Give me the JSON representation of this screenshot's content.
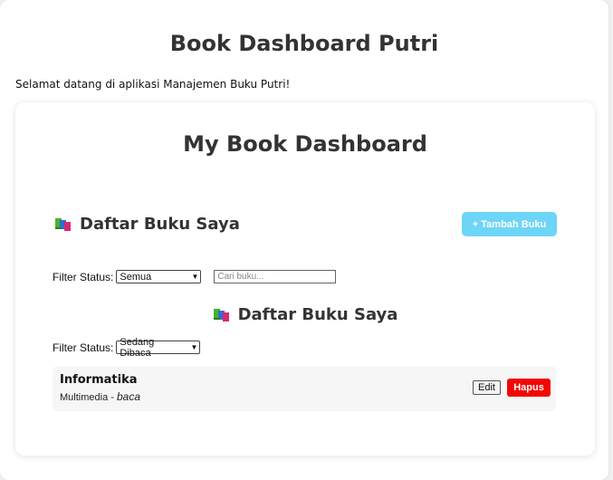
{
  "page": {
    "title": "Book Dashboard Putri",
    "welcome": "Selamat datang di aplikasi Manajemen Buku Putri!"
  },
  "dashboard": {
    "title": "My Book Dashboard",
    "section_title": "Daftar Buku Saya",
    "section_icon": "books-icon",
    "add_button": "+ Tambah Buku",
    "filter": {
      "label": "Filter Status:",
      "selected": "Semua",
      "search_placeholder": "Cari buku..."
    },
    "list": {
      "title": "Daftar Buku Saya",
      "filter_label": "Filter Status:",
      "filter_selected": "Sedang Dibaca",
      "books": [
        {
          "title": "Informatika",
          "category": "Multimedia",
          "separator": "-",
          "status": "baca",
          "edit_label": "Edit",
          "delete_label": "Hapus"
        }
      ]
    }
  },
  "colors": {
    "add_button": "#6dd5f7",
    "delete_button": "#f20707"
  }
}
